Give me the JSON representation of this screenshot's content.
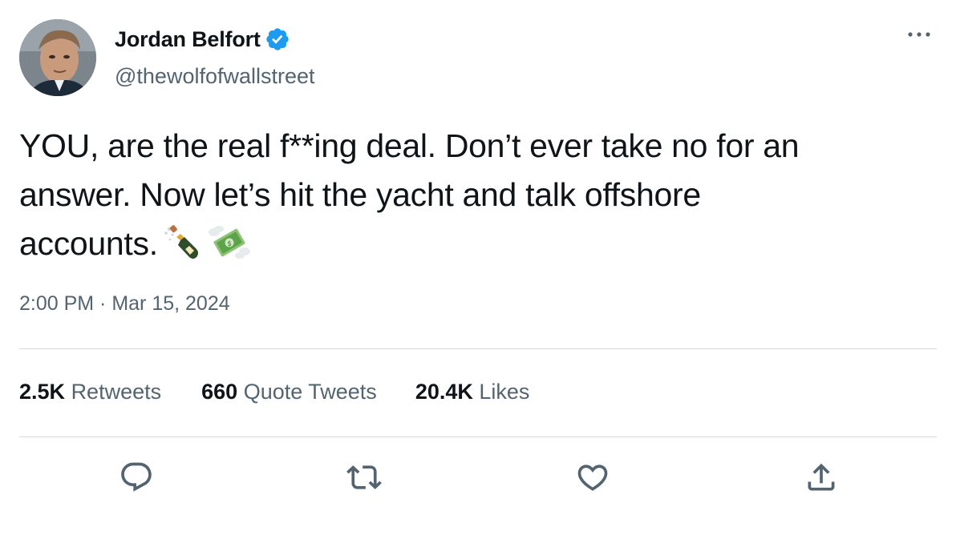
{
  "user": {
    "display_name": "Jordan Belfort",
    "handle": "@thewolfofwallstreet",
    "verified": true
  },
  "tweet": {
    "text_lines": [
      "YOU, are the real f**ing deal. Don’t ever take no for an",
      "answer. Now let’s hit the yacht and talk offshore",
      "accounts."
    ],
    "emojis": [
      "champagne-bottle-emoji",
      "money-with-wings-emoji"
    ],
    "timestamp": "2:00 PM · Mar 15, 2024"
  },
  "stats": {
    "retweets": {
      "count": "2.5K",
      "label": "Retweets"
    },
    "quote_tweets": {
      "count": "660",
      "label": "Quote Tweets"
    },
    "likes": {
      "count": "20.4K",
      "label": "Likes"
    }
  },
  "actions": [
    "reply-icon",
    "retweet-icon",
    "like-icon",
    "share-icon"
  ],
  "colors": {
    "text_primary": "#0f1419",
    "text_secondary": "#536471",
    "verified_blue": "#1d9bf0",
    "divider": "#cfd9de"
  }
}
